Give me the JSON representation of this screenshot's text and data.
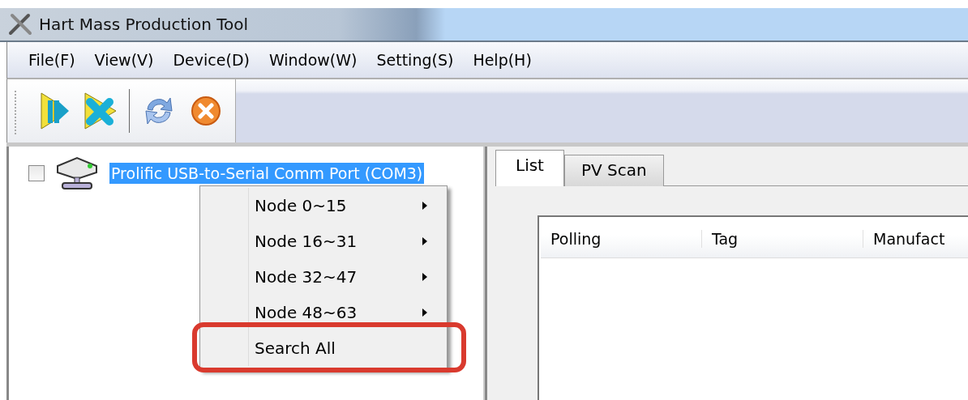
{
  "window": {
    "title": "Hart Mass Production Tool"
  },
  "menu_bar": [
    "File(F)",
    "View(V)",
    "Device(D)",
    "Window(W)",
    "Setting(S)",
    "Help(H)"
  ],
  "toolbar": [
    {
      "kind": "start"
    },
    {
      "kind": "stop"
    },
    {
      "kind": "separator"
    },
    {
      "kind": "refresh"
    },
    {
      "kind": "cancel"
    }
  ],
  "tree": [
    {
      "label": "Prolific USB-to-Serial Comm Port (COM3)",
      "checked": false,
      "selected": true
    }
  ],
  "context_menu": [
    {
      "label": "Node 0~15",
      "kind": "submenu",
      "highlighted": false
    },
    {
      "label": "Node 16~31",
      "kind": "submenu",
      "highlighted": false
    },
    {
      "label": "Node 32~47",
      "kind": "submenu",
      "highlighted": false
    },
    {
      "label": "Node 48~63",
      "kind": "submenu",
      "highlighted": false
    },
    {
      "label": "Search All",
      "kind": "action",
      "highlighted": true
    }
  ],
  "tabs": [
    {
      "label": "List",
      "selected": true
    },
    {
      "label": "PV Scan",
      "selected": false
    }
  ],
  "table": {
    "columns": [
      "Polling",
      "Tag",
      "Manufact"
    ]
  }
}
